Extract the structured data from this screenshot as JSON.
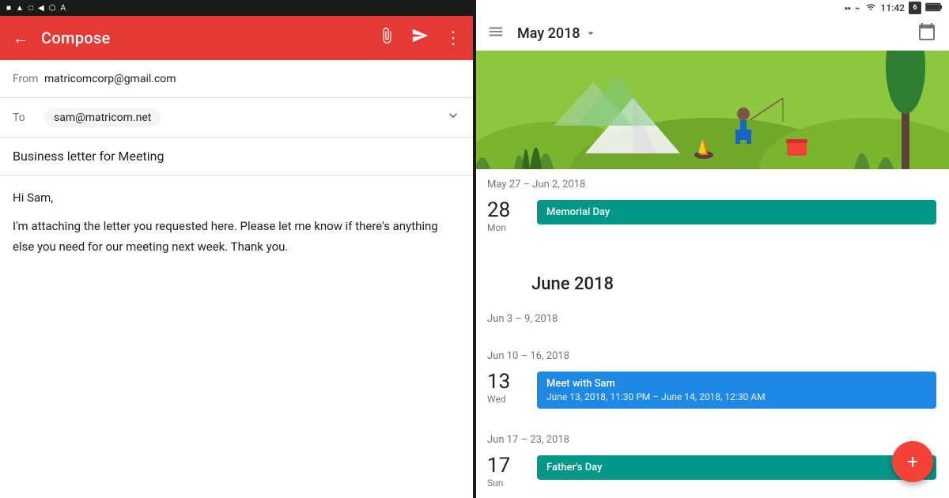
{
  "left": {
    "statusBar": {
      "icons": [
        "■",
        "▲",
        "□",
        "◀",
        "⬡",
        "A"
      ]
    },
    "toolbar": {
      "backLabel": "←",
      "title": "Compose",
      "attachIcon": "⊕",
      "sendIcon": "▶",
      "moreIcon": "⋮"
    },
    "from": {
      "label": "From",
      "value": "matricomcorp@gmail.com"
    },
    "to": {
      "label": "To",
      "value": "sam@matricom.net",
      "expandIcon": "∨"
    },
    "subject": {
      "value": "Business letter for Meeting"
    },
    "body": {
      "greeting": "Hi Sam,",
      "content": "I'm attaching the letter you requested here. Please let me know if there's anything else you need for our meeting next week. Thank you."
    }
  },
  "right": {
    "statusBar": {
      "batteryIcon": "🔋",
      "bluetoothIcon": "⌘",
      "wifiIcon": "wifi",
      "time": "11:42",
      "calendarIcon": "6"
    },
    "header": {
      "menuIcon": "☰",
      "title": "May 2018",
      "dropdownIcon": "▾"
    },
    "weekRanges": {
      "range1": "May 27 – Jun 2, 2018",
      "range2": "Jun 3 – 9, 2018",
      "range3": "Jun 10 – 16, 2018",
      "range4": "Jun 17 – 23, 2018"
    },
    "events": [
      {
        "dateNum": "28",
        "dateDay": "Mon",
        "title": "Memorial Day",
        "type": "teal",
        "subtitle": null
      },
      {
        "dateNum": "13",
        "dateDay": "Wed",
        "title": "Meet with Sam",
        "type": "blue",
        "subtitle": "June 13, 2018, 11:30 PM – June 14, 2018, 12:30 AM"
      },
      {
        "dateNum": "17",
        "dateDay": "Sun",
        "title": "Father's Day",
        "type": "teal",
        "subtitle": null
      }
    ],
    "monthHeaders": {
      "june": "June 2018"
    },
    "fab": {
      "icon": "+"
    }
  }
}
